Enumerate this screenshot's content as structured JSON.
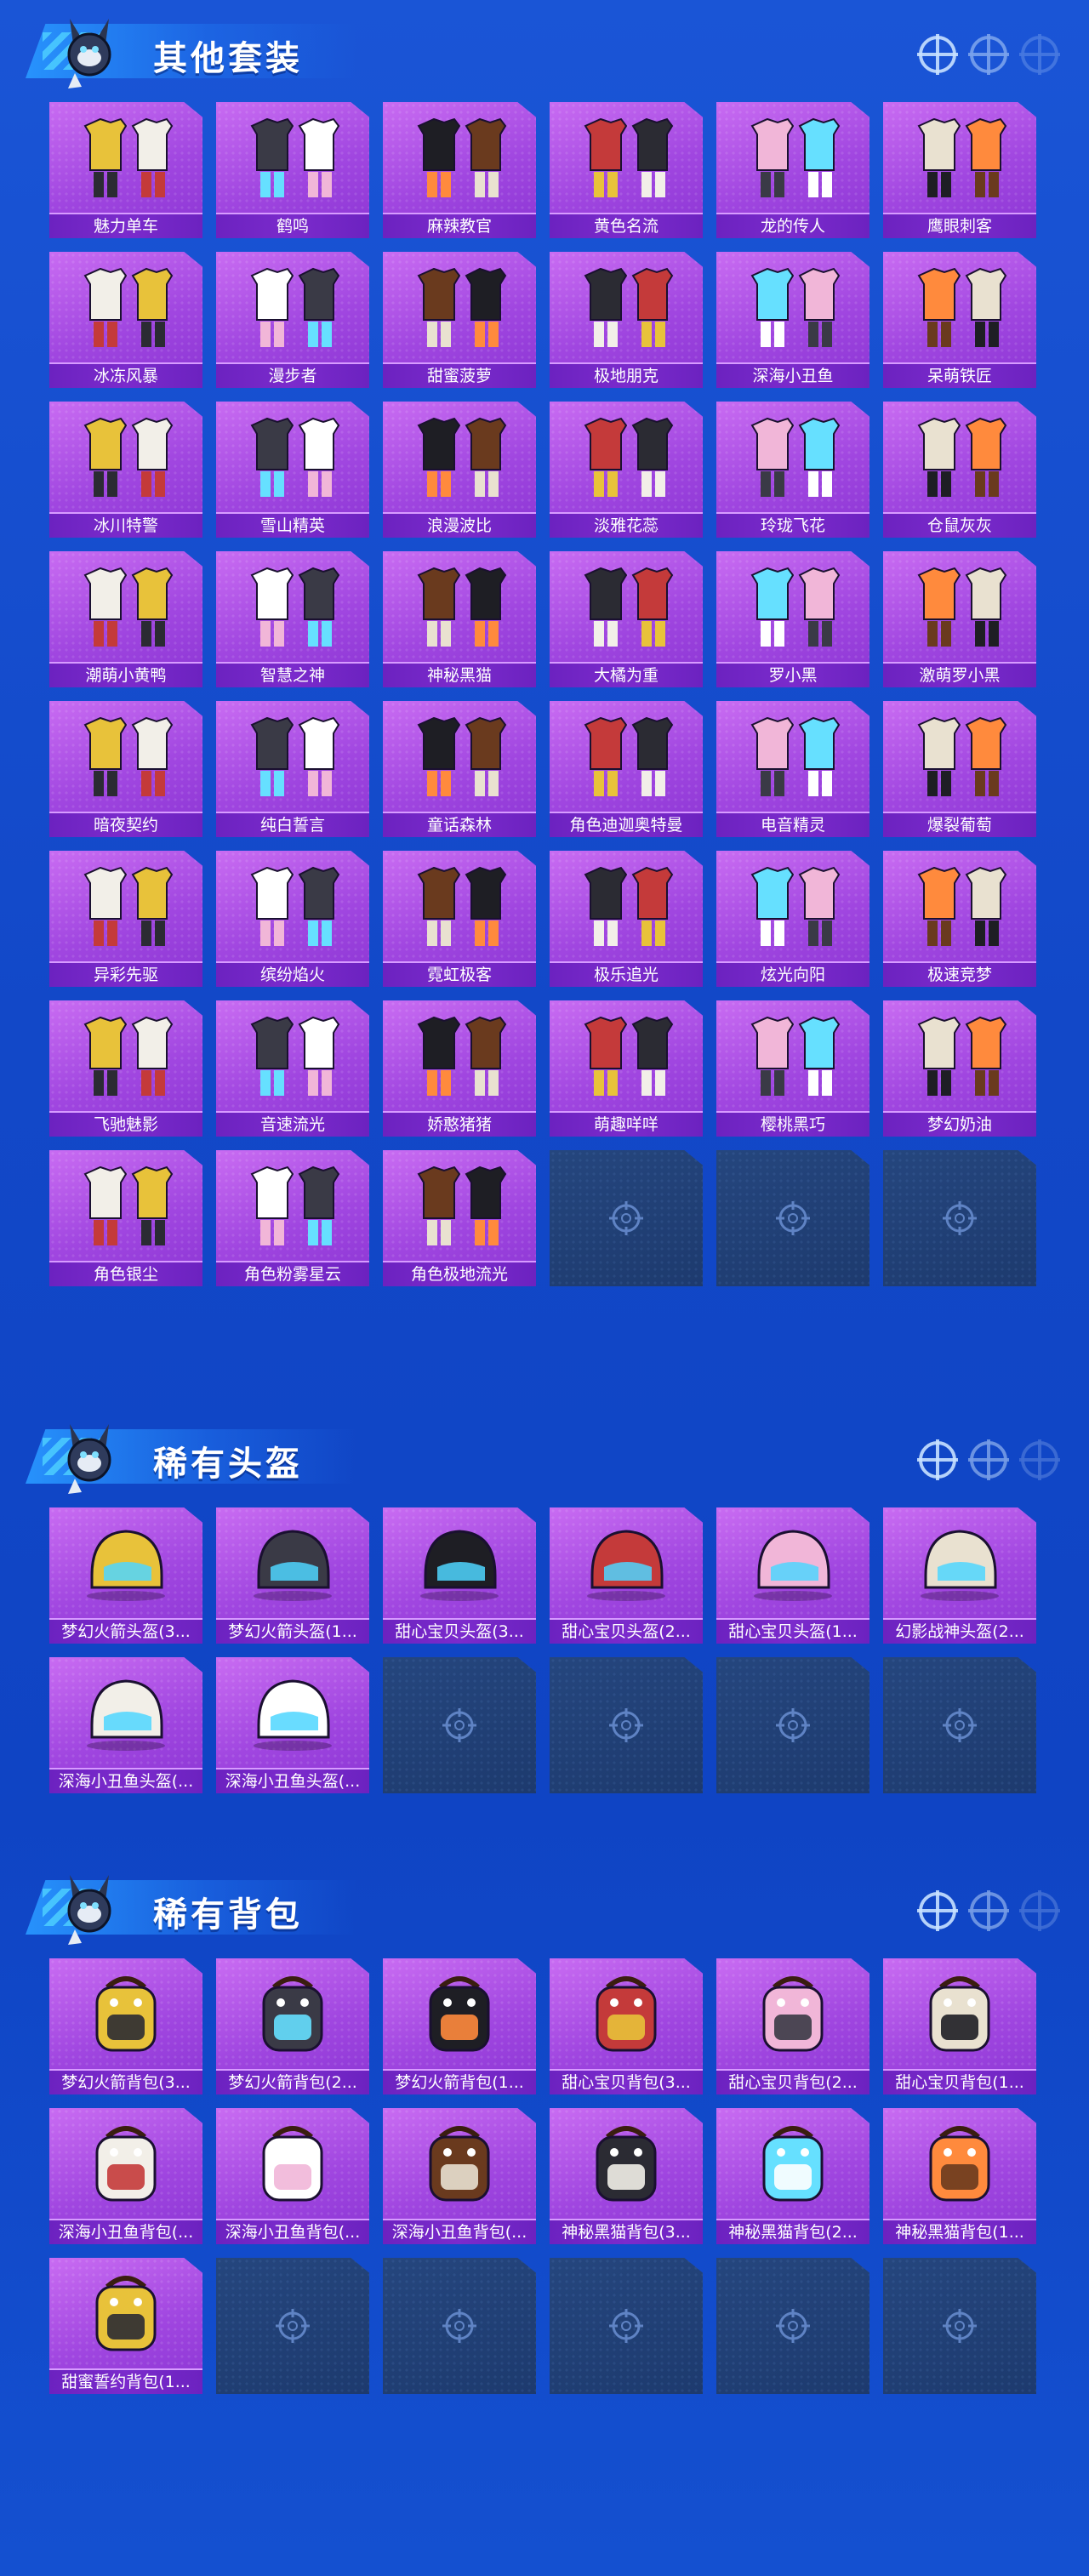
{
  "sections": [
    {
      "title": "其他套装",
      "items": [
        {
          "label": "魅力单车",
          "icon": "outfit-icon"
        },
        {
          "label": "鹤鸣",
          "icon": "outfit-icon"
        },
        {
          "label": "麻辣教官",
          "icon": "outfit-icon"
        },
        {
          "label": "黄色名流",
          "icon": "outfit-icon"
        },
        {
          "label": "龙的传人",
          "icon": "outfit-icon"
        },
        {
          "label": "鹰眼刺客",
          "icon": "outfit-icon"
        },
        {
          "label": "冰冻风暴",
          "icon": "outfit-icon"
        },
        {
          "label": "漫步者",
          "icon": "outfit-icon"
        },
        {
          "label": "甜蜜菠萝",
          "icon": "outfit-icon"
        },
        {
          "label": "极地朋克",
          "icon": "outfit-icon"
        },
        {
          "label": "深海小丑鱼",
          "icon": "outfit-icon"
        },
        {
          "label": "呆萌铁匠",
          "icon": "outfit-icon"
        },
        {
          "label": "冰川特警",
          "icon": "outfit-icon"
        },
        {
          "label": "雪山精英",
          "icon": "outfit-icon"
        },
        {
          "label": "浪漫波比",
          "icon": "outfit-icon"
        },
        {
          "label": "淡雅花蕊",
          "icon": "outfit-icon"
        },
        {
          "label": "玲珑飞花",
          "icon": "outfit-icon"
        },
        {
          "label": "仓鼠灰灰",
          "icon": "outfit-icon"
        },
        {
          "label": "潮萌小黄鸭",
          "icon": "outfit-icon"
        },
        {
          "label": "智慧之神",
          "icon": "outfit-icon"
        },
        {
          "label": "神秘黑猫",
          "icon": "outfit-icon"
        },
        {
          "label": "大橘为重",
          "icon": "outfit-icon"
        },
        {
          "label": "罗小黑",
          "icon": "outfit-icon"
        },
        {
          "label": "激萌罗小黑",
          "icon": "outfit-icon"
        },
        {
          "label": "暗夜契约",
          "icon": "outfit-icon"
        },
        {
          "label": "纯白誓言",
          "icon": "outfit-icon"
        },
        {
          "label": "童话森林",
          "icon": "outfit-icon"
        },
        {
          "label": "角色迪迦奥特曼",
          "icon": "outfit-icon"
        },
        {
          "label": "电音精灵",
          "icon": "outfit-icon"
        },
        {
          "label": "爆裂葡萄",
          "icon": "outfit-icon"
        },
        {
          "label": "异彩先驱",
          "icon": "outfit-icon"
        },
        {
          "label": "缤纷焰火",
          "icon": "outfit-icon"
        },
        {
          "label": "霓虹极客",
          "icon": "outfit-icon"
        },
        {
          "label": "极乐追光",
          "icon": "outfit-icon"
        },
        {
          "label": "炫光向阳",
          "icon": "outfit-icon"
        },
        {
          "label": "极速竞梦",
          "icon": "outfit-icon"
        },
        {
          "label": "飞驰魅影",
          "icon": "outfit-icon"
        },
        {
          "label": "音速流光",
          "icon": "outfit-icon"
        },
        {
          "label": "娇憨猪猪",
          "icon": "outfit-icon"
        },
        {
          "label": "萌趣咩咩",
          "icon": "outfit-icon"
        },
        {
          "label": "樱桃黑巧",
          "icon": "outfit-icon"
        },
        {
          "label": "梦幻奶油",
          "icon": "outfit-icon"
        },
        {
          "label": "角色银尘",
          "icon": "outfit-icon"
        },
        {
          "label": "角色粉雾星云",
          "icon": "outfit-icon"
        },
        {
          "label": "角色极地流光",
          "icon": "outfit-icon"
        }
      ],
      "empty_slots": 3
    },
    {
      "title": "稀有头盔",
      "items": [
        {
          "label": "梦幻火箭头盔(3...",
          "icon": "helmet-icon"
        },
        {
          "label": "梦幻火箭头盔(1...",
          "icon": "helmet-icon"
        },
        {
          "label": "甜心宝贝头盔(3...",
          "icon": "helmet-icon"
        },
        {
          "label": "甜心宝贝头盔(2...",
          "icon": "helmet-icon"
        },
        {
          "label": "甜心宝贝头盔(1...",
          "icon": "helmet-icon"
        },
        {
          "label": "幻影战神头盔(2...",
          "icon": "helmet-icon"
        },
        {
          "label": "深海小丑鱼头盔(...",
          "icon": "helmet-icon"
        },
        {
          "label": "深海小丑鱼头盔(...",
          "icon": "helmet-icon"
        }
      ],
      "empty_slots": 4
    },
    {
      "title": "稀有背包",
      "items": [
        {
          "label": "梦幻火箭背包(3...",
          "icon": "backpack-icon"
        },
        {
          "label": "梦幻火箭背包(2...",
          "icon": "backpack-icon"
        },
        {
          "label": "梦幻火箭背包(1...",
          "icon": "backpack-icon"
        },
        {
          "label": "甜心宝贝背包(3...",
          "icon": "backpack-icon"
        },
        {
          "label": "甜心宝贝背包(2...",
          "icon": "backpack-icon"
        },
        {
          "label": "甜心宝贝背包(1...",
          "icon": "backpack-icon"
        },
        {
          "label": "深海小丑鱼背包(...",
          "icon": "backpack-icon"
        },
        {
          "label": "深海小丑鱼背包(...",
          "icon": "backpack-icon"
        },
        {
          "label": "深海小丑鱼背包(...",
          "icon": "backpack-icon"
        },
        {
          "label": "神秘黑猫背包(3...",
          "icon": "backpack-icon"
        },
        {
          "label": "神秘黑猫背包(2...",
          "icon": "backpack-icon"
        },
        {
          "label": "神秘黑猫背包(1...",
          "icon": "backpack-icon"
        },
        {
          "label": "甜蜜誓约背包(1...",
          "icon": "backpack-icon"
        }
      ],
      "empty_slots": 5
    }
  ],
  "colors": {
    "background": "#1450d0",
    "card": "#a046e0",
    "card_label": "#6c22c0",
    "empty_card": "#1d3a6e"
  }
}
